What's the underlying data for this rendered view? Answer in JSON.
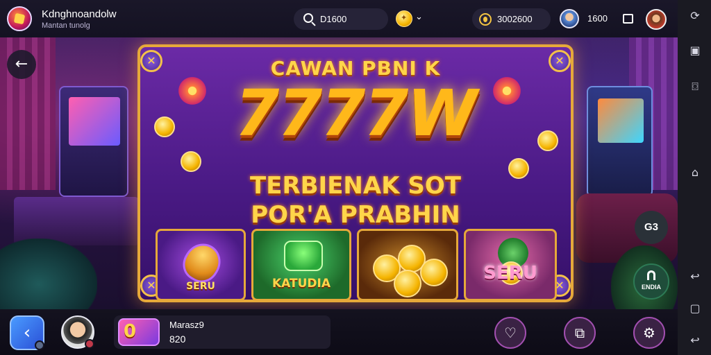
{
  "header": {
    "app_title": "Kdnghnoandolw",
    "app_subtitle": "Mantan tunolg",
    "search_value": "D1600",
    "balance": "3002600",
    "count": "1600"
  },
  "banner": {
    "headline": "CAWAN PBNI K",
    "big_title": "7777W",
    "subtitle_line1": "TERBIENAK SOT",
    "subtitle_line2": "POR'A PRABHIN",
    "tiles": [
      {
        "label": "SERU"
      },
      {
        "label": "KATUDIA"
      },
      {
        "label": ""
      },
      {
        "label": "SERU"
      }
    ]
  },
  "side": {
    "gg_label": "G3",
    "package_label": "ENDIA"
  },
  "footer": {
    "game_name": "Marasz9",
    "game_value": "820"
  },
  "icons": [
    "back-arrow-icon",
    "search-icon",
    "coin-icon",
    "chevron-icon",
    "square-icon",
    "heart-icon",
    "bookmark-icon",
    "gear-icon"
  ],
  "colors": {
    "accent_gold": "#ffb81a",
    "banner_purple": "#4a1a85",
    "frame_gold": "#e6a93a"
  }
}
